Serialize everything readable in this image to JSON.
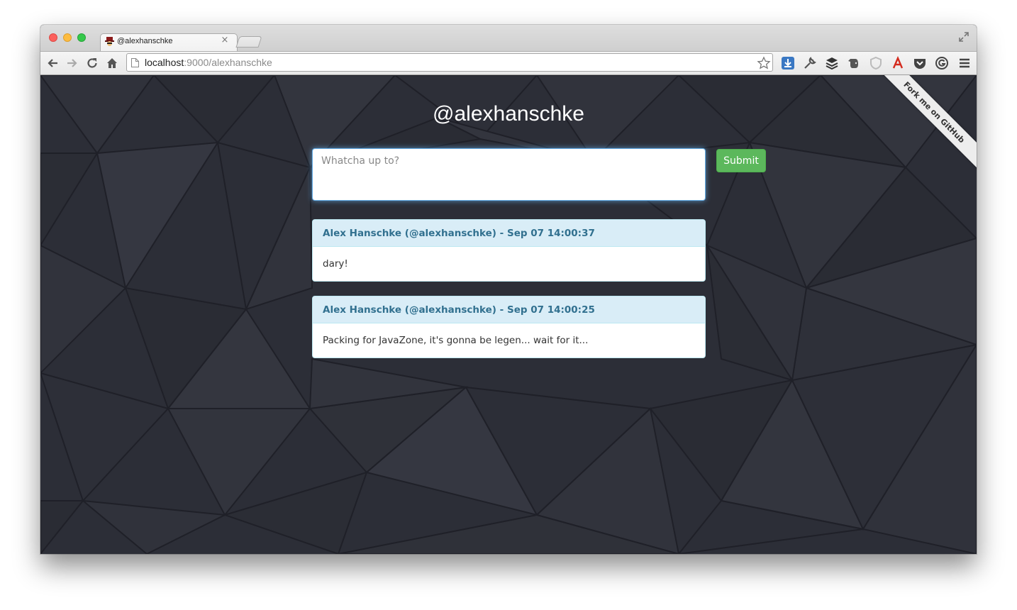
{
  "browser": {
    "tab_title": "@alexhanschke",
    "tab_close": "×",
    "url_host": "localhost",
    "url_rest": ":9000/alexhanschke"
  },
  "toolbar_icons": [
    "back-arrow-icon",
    "forward-arrow-icon",
    "reload-icon",
    "home-icon",
    "bookmark-star-icon",
    "download-extension-icon",
    "wrench-icon",
    "layers-extension-icon",
    "evernote-extension-icon",
    "shield-extension-icon",
    "acrobat-extension-icon",
    "pocket-extension-icon",
    "g-extension-icon",
    "menu-icon"
  ],
  "page": {
    "title": "@alexhanschke",
    "input_placeholder": "Whatcha up to?",
    "input_value": "",
    "submit_label": "Submit",
    "ribbon_label": "Fork me on GitHub"
  },
  "statuses": [
    {
      "header": "Alex Hanschke (@alexhanschke) - Sep 07 14:00:37",
      "body": "dary!"
    },
    {
      "header": "Alex Hanschke (@alexhanschke) - Sep 07 14:00:25",
      "body": "Packing for JavaZone, it's gonna be legen... wait for it..."
    }
  ],
  "colors": {
    "page_background": "#2c2e37",
    "submit_green": "#5cb85c",
    "card_header_blue": "#d9edf7",
    "card_header_text": "#31708f"
  }
}
